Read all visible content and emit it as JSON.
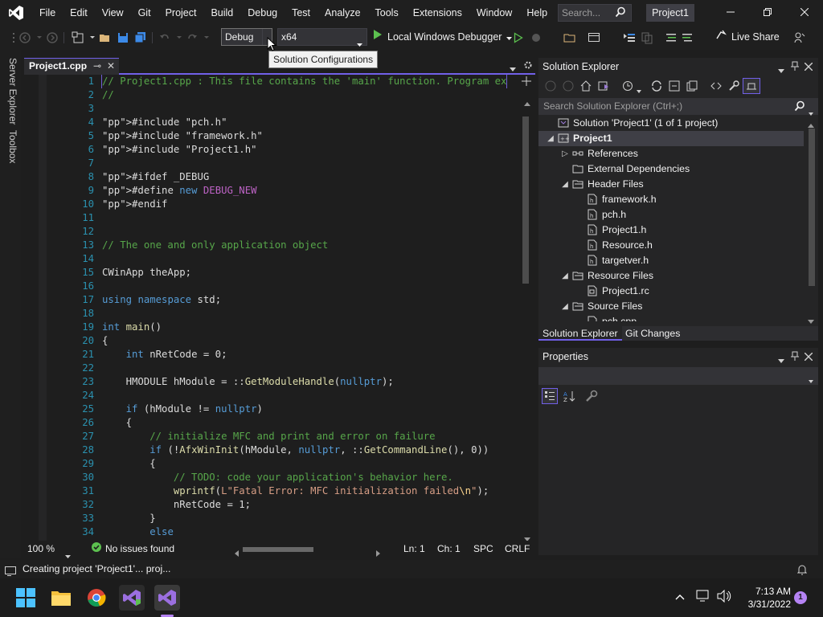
{
  "window": {
    "menu": [
      "File",
      "Edit",
      "View",
      "Git",
      "Project",
      "Build",
      "Debug",
      "Test",
      "Analyze",
      "Tools",
      "Extensions",
      "Window",
      "Help"
    ],
    "search_placeholder": "Search...",
    "project_name": "Project1"
  },
  "toolbar": {
    "configuration": "Debug",
    "platform": "x64",
    "debugger_label": "Local Windows Debugger",
    "live_share": "Live Share",
    "tooltip": "Solution Configurations"
  },
  "siderail": {
    "server_explorer": "Server Explorer",
    "toolbox": "Toolbox"
  },
  "editor": {
    "tab_label": "Project1.cpp",
    "pin_glyph": "⊸",
    "close_glyph": "✕",
    "lines": [
      {
        "n": "1",
        "text": "// Project1.cpp : This file contains the 'main' function. Program ex"
      },
      {
        "n": "2",
        "text": "//"
      },
      {
        "n": "3",
        "text": ""
      },
      {
        "n": "4",
        "text": "#include \"pch.h\""
      },
      {
        "n": "5",
        "text": "#include \"framework.h\""
      },
      {
        "n": "6",
        "text": "#include \"Project1.h\""
      },
      {
        "n": "7",
        "text": ""
      },
      {
        "n": "8",
        "text": "#ifdef _DEBUG"
      },
      {
        "n": "9",
        "text": "#define new DEBUG_NEW"
      },
      {
        "n": "10",
        "text": "#endif"
      },
      {
        "n": "11",
        "text": ""
      },
      {
        "n": "12",
        "text": ""
      },
      {
        "n": "13",
        "text": "// The one and only application object"
      },
      {
        "n": "14",
        "text": ""
      },
      {
        "n": "15",
        "text": "CWinApp theApp;"
      },
      {
        "n": "16",
        "text": ""
      },
      {
        "n": "17",
        "text": "using namespace std;"
      },
      {
        "n": "18",
        "text": ""
      },
      {
        "n": "19",
        "text": "int main()"
      },
      {
        "n": "20",
        "text": "{"
      },
      {
        "n": "21",
        "text": "    int nRetCode = 0;"
      },
      {
        "n": "22",
        "text": ""
      },
      {
        "n": "23",
        "text": "    HMODULE hModule = ::GetModuleHandle(nullptr);"
      },
      {
        "n": "24",
        "text": ""
      },
      {
        "n": "25",
        "text": "    if (hModule != nullptr)"
      },
      {
        "n": "26",
        "text": "    {"
      },
      {
        "n": "27",
        "text": "        // initialize MFC and print and error on failure"
      },
      {
        "n": "28",
        "text": "        if (!AfxWinInit(hModule, nullptr, ::GetCommandLine(), 0))"
      },
      {
        "n": "29",
        "text": "        {"
      },
      {
        "n": "30",
        "text": "            // TODO: code your application's behavior here."
      },
      {
        "n": "31",
        "text": "            wprintf(L\"Fatal Error: MFC initialization failed\\n\");"
      },
      {
        "n": "32",
        "text": "            nRetCode = 1;"
      },
      {
        "n": "33",
        "text": "        }"
      },
      {
        "n": "34",
        "text": "        else"
      }
    ],
    "status": {
      "zoom": "100 %",
      "issues": "No issues found",
      "line": "Ln: 1",
      "col": "Ch: 1",
      "spc": "SPC",
      "eol": "CRLF"
    }
  },
  "solution_explorer": {
    "title": "Solution Explorer",
    "search_placeholder": "Search Solution Explorer (Ctrl+;)",
    "tree": [
      {
        "label": "Solution 'Project1' (1 of 1 project)",
        "depth": 0,
        "exp": "",
        "icon": "solution-icon",
        "bold": false
      },
      {
        "label": "Project1",
        "depth": 1,
        "exp": "◢",
        "icon": "project-icon",
        "bold": true
      },
      {
        "label": "References",
        "depth": 2,
        "exp": "▷",
        "icon": "references-icon",
        "bold": false
      },
      {
        "label": "External Dependencies",
        "depth": 2,
        "exp": "",
        "icon": "external-deps-icon",
        "bold": false
      },
      {
        "label": "Header Files",
        "depth": 2,
        "exp": "◢",
        "icon": "folder-icon",
        "bold": false
      },
      {
        "label": "framework.h",
        "depth": 3,
        "exp": "",
        "icon": "header-file-icon",
        "bold": false
      },
      {
        "label": "pch.h",
        "depth": 3,
        "exp": "",
        "icon": "header-file-icon",
        "bold": false
      },
      {
        "label": "Project1.h",
        "depth": 3,
        "exp": "",
        "icon": "header-file-icon",
        "bold": false
      },
      {
        "label": "Resource.h",
        "depth": 3,
        "exp": "",
        "icon": "header-file-icon",
        "bold": false
      },
      {
        "label": "targetver.h",
        "depth": 3,
        "exp": "",
        "icon": "header-file-icon",
        "bold": false
      },
      {
        "label": "Resource Files",
        "depth": 2,
        "exp": "◢",
        "icon": "folder-icon",
        "bold": false
      },
      {
        "label": "Project1.rc",
        "depth": 3,
        "exp": "",
        "icon": "resource-file-icon",
        "bold": false
      },
      {
        "label": "Source Files",
        "depth": 2,
        "exp": "◢",
        "icon": "folder-icon",
        "bold": false
      },
      {
        "label": "pch.cpp",
        "depth": 3,
        "exp": "",
        "icon": "cpp-file-icon",
        "bold": false
      }
    ],
    "tabs": [
      "Solution Explorer",
      "Git Changes"
    ]
  },
  "properties": {
    "title": "Properties"
  },
  "statusbar": {
    "message": "Creating project 'Project1'... proj..."
  },
  "taskbar": {
    "time": "7:13 AM",
    "date": "3/31/2022",
    "notifications": "1"
  },
  "colors": {
    "accent": "#7160e8",
    "comment": "#57a64a",
    "keyword": "#569cd6",
    "string": "#d69d85",
    "line_number": "#2b91af"
  }
}
